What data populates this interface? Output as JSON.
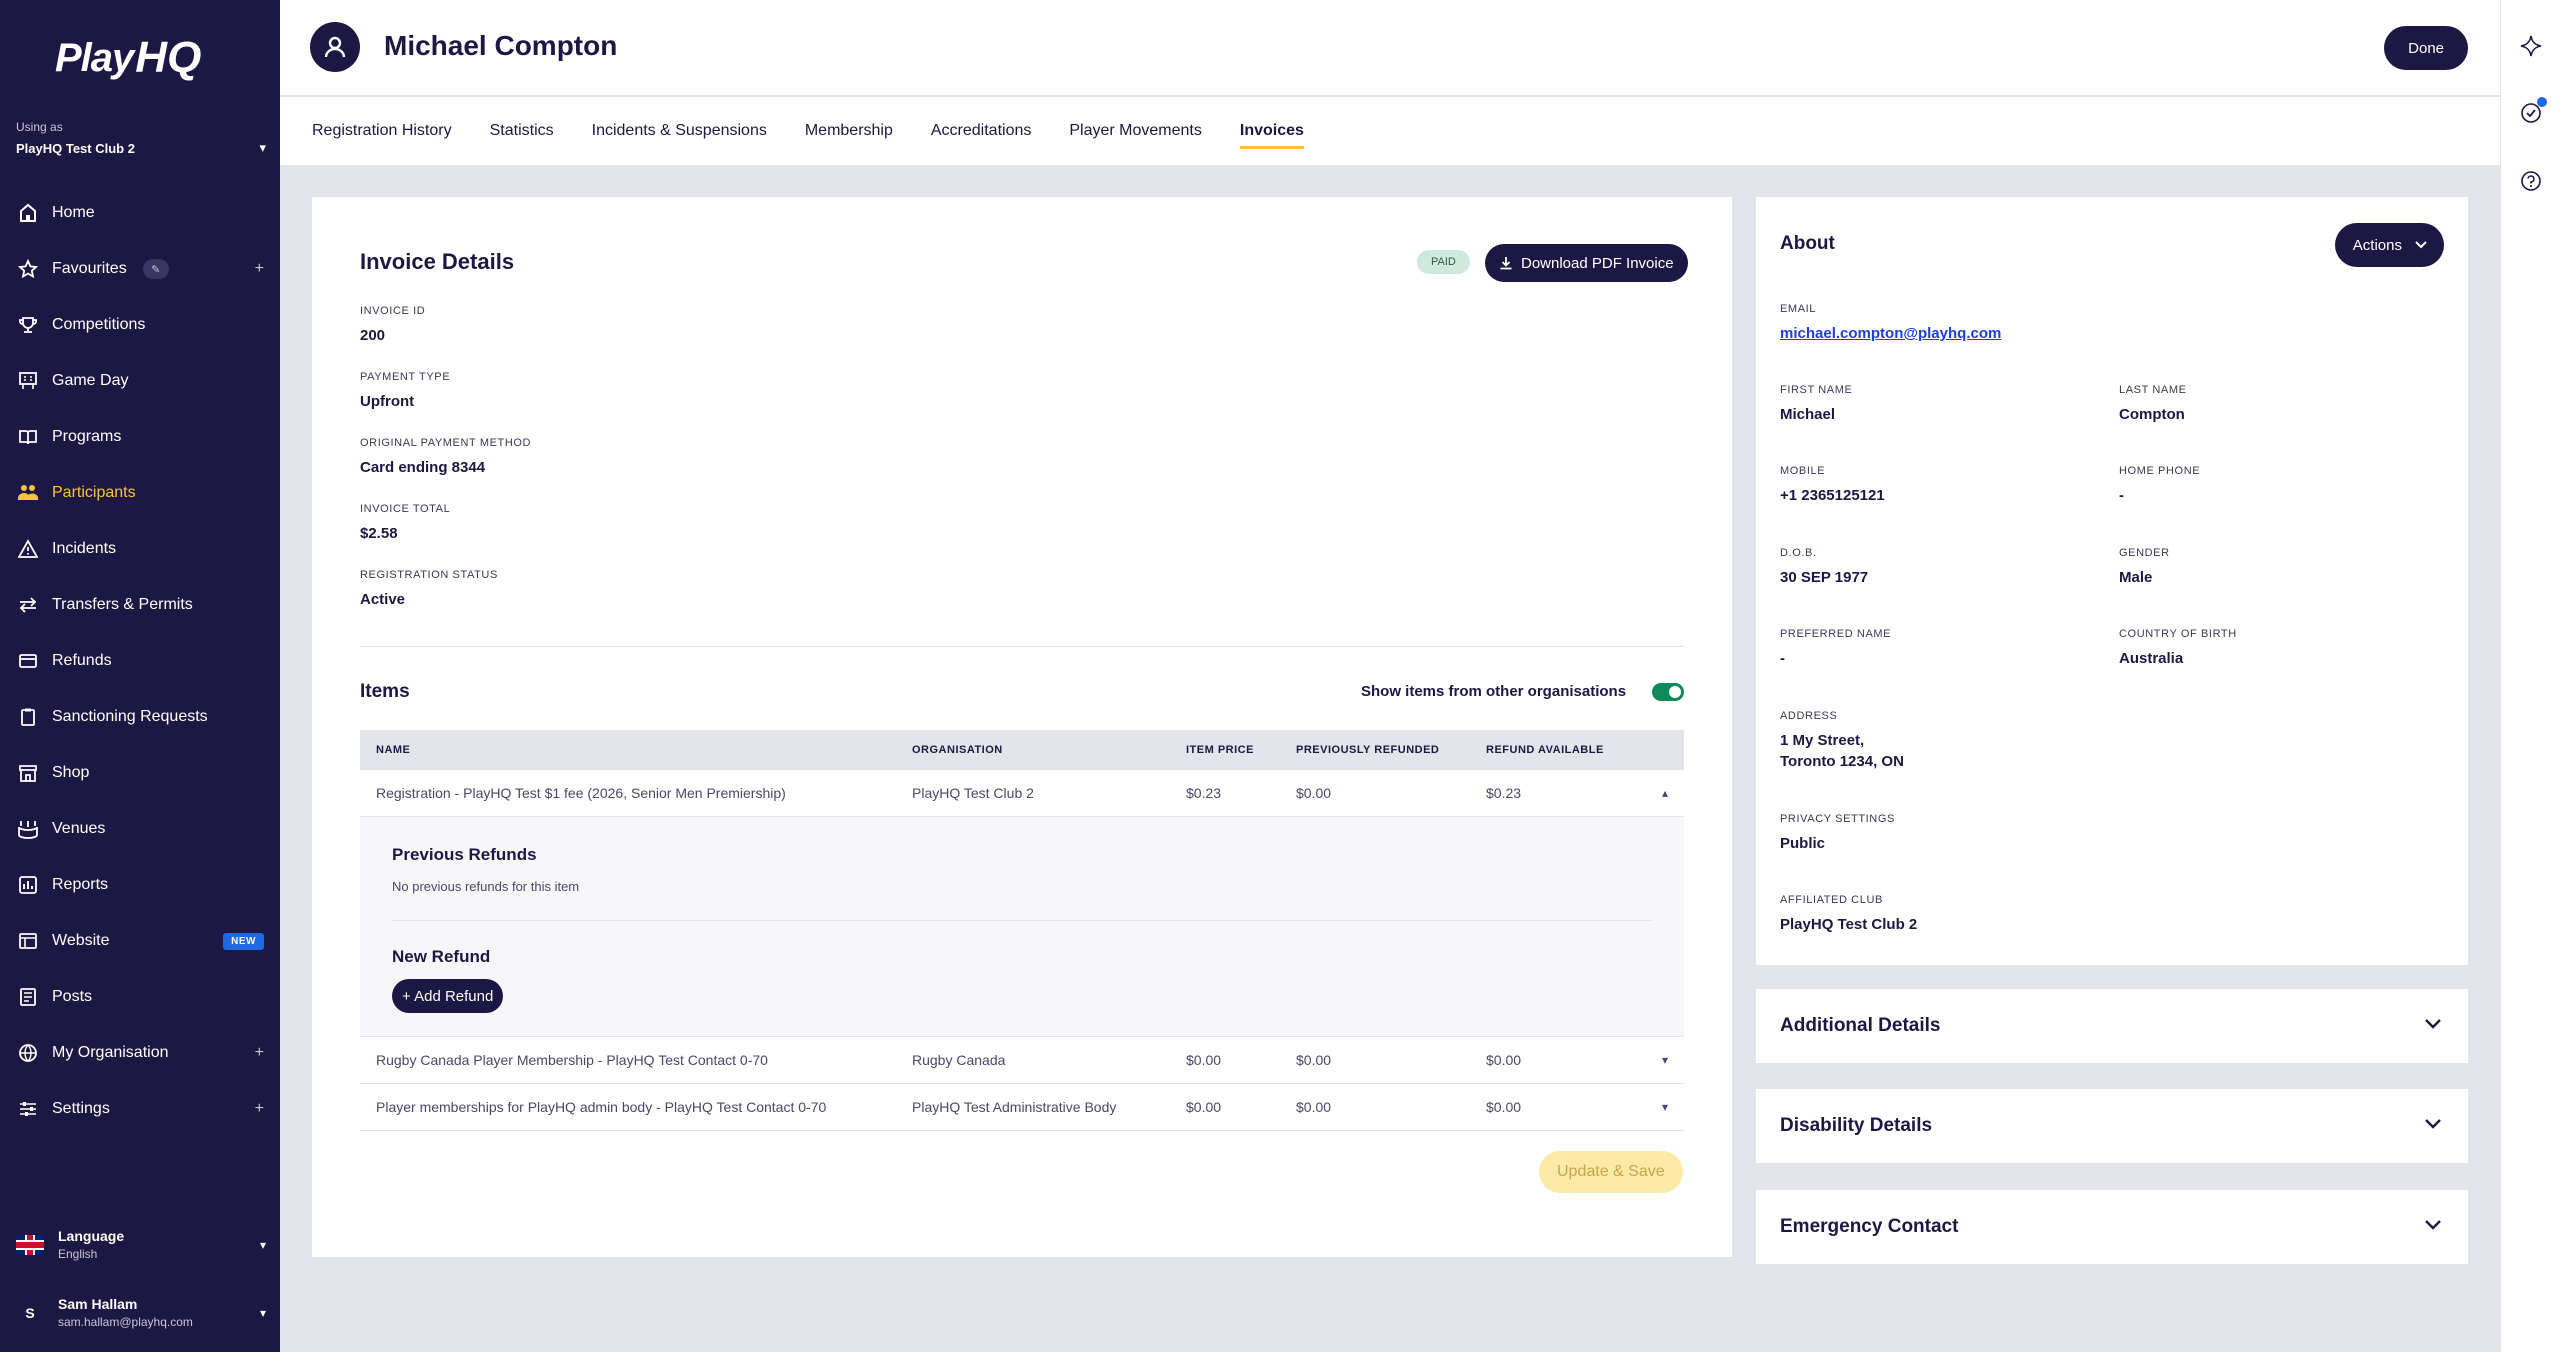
{
  "sidebar": {
    "logo_play": "Play",
    "logo_hq": "HQ",
    "using_as_label": "Using as",
    "org_name": "PlayHQ Test Club 2",
    "items": [
      {
        "label": "Home",
        "icon": "home-icon"
      },
      {
        "label": "Favourites",
        "icon": "star-icon"
      },
      {
        "label": "Competitions",
        "icon": "trophy-icon"
      },
      {
        "label": "Game Day",
        "icon": "scoreboard-icon"
      },
      {
        "label": "Programs",
        "icon": "book-icon"
      },
      {
        "label": "Participants",
        "icon": "people-icon"
      },
      {
        "label": "Incidents",
        "icon": "warning-icon"
      },
      {
        "label": "Transfers & Permits",
        "icon": "transfer-icon"
      },
      {
        "label": "Refunds",
        "icon": "card-icon"
      },
      {
        "label": "Sanctioning Requests",
        "icon": "clipboard-icon"
      },
      {
        "label": "Shop",
        "icon": "shop-icon"
      },
      {
        "label": "Venues",
        "icon": "stadium-icon"
      },
      {
        "label": "Reports",
        "icon": "report-icon"
      },
      {
        "label": "Website",
        "icon": "website-icon"
      },
      {
        "label": "Posts",
        "icon": "posts-icon"
      },
      {
        "label": "My Organisation",
        "icon": "globe-icon"
      },
      {
        "label": "Settings",
        "icon": "sliders-icon"
      }
    ],
    "website_badge": "NEW",
    "plus_symbol": "+",
    "language_label": "Language",
    "language_value": "English",
    "user_initial": "S",
    "user_name": "Sam Hallam",
    "user_email": "sam.hallam@playhq.com"
  },
  "header": {
    "title": "Michael Compton",
    "done_label": "Done"
  },
  "tabs": [
    {
      "label": "Registration History"
    },
    {
      "label": "Statistics"
    },
    {
      "label": "Incidents & Suspensions"
    },
    {
      "label": "Membership"
    },
    {
      "label": "Accreditations"
    },
    {
      "label": "Player Movements"
    },
    {
      "label": "Invoices",
      "active": true
    }
  ],
  "invoice": {
    "title": "Invoice Details",
    "status_badge": "PAID",
    "download_label": "Download PDF Invoice",
    "fields": [
      {
        "label": "Invoice ID",
        "value": "200"
      },
      {
        "label": "Payment Type",
        "value": "Upfront"
      },
      {
        "label": "Original Payment Method",
        "value": "Card ending 8344"
      },
      {
        "label": "Invoice Total",
        "value": "$2.58"
      },
      {
        "label": "Registration Status",
        "value": "Active"
      }
    ],
    "items_title": "Items",
    "toggle_label": "Show items from other organisations",
    "table": {
      "headers": [
        "NAME",
        "ORGANISATION",
        "ITEM PRICE",
        "PREVIOUSLY REFUNDED",
        "REFUND AVAILABLE"
      ],
      "rows": [
        {
          "name": "Registration - PlayHQ Test $1 fee (2026, Senior Men Premiership)",
          "org": "PlayHQ Test Club 2",
          "price": "$0.23",
          "prev": "$0.00",
          "avail": "$0.23",
          "toggle": "▴"
        },
        {
          "name": "Rugby Canada Player Membership - PlayHQ Test Contact 0-70",
          "org": "Rugby Canada",
          "price": "$0.00",
          "prev": "$0.00",
          "avail": "$0.00",
          "toggle": "▾"
        },
        {
          "name": "Player memberships for PlayHQ admin body - PlayHQ Test Contact 0-70",
          "org": "PlayHQ Test Administrative Body",
          "price": "$0.00",
          "prev": "$0.00",
          "avail": "$0.00",
          "toggle": "▾"
        }
      ]
    },
    "expanded": {
      "prev_title": "Previous Refunds",
      "prev_text": "No previous refunds for this item",
      "new_title": "New Refund",
      "add_label": "+ Add Refund"
    },
    "save_label": "Update & Save"
  },
  "about": {
    "title": "About",
    "actions_label": "Actions",
    "email_label": "EMAIL",
    "email": "michael.compton@playhq.com",
    "fields": [
      {
        "label": "FIRST NAME",
        "value": "Michael"
      },
      {
        "label": "LAST NAME",
        "value": "Compton"
      },
      {
        "label": "MOBILE",
        "value": "+1 2365125121"
      },
      {
        "label": "HOME PHONE",
        "value": "-"
      },
      {
        "label": "D.O.B.",
        "value": "30 SEP 1977"
      },
      {
        "label": "GENDER",
        "value": "Male"
      },
      {
        "label": "PREFERRED NAME",
        "value": "-"
      },
      {
        "label": "COUNTRY OF BIRTH",
        "value": "Australia"
      }
    ],
    "address_label": "ADDRESS",
    "address_line1": "1 My Street,",
    "address_line2": "Toronto 1234, ON",
    "privacy_label": "PRIVACY SETTINGS",
    "privacy_value": "Public",
    "club_label": "AFFILIATED CLUB",
    "club_value": "PlayHQ Test Club 2"
  },
  "accordions": [
    {
      "label": "Additional Details"
    },
    {
      "label": "Disability Details"
    },
    {
      "label": "Emergency Contact"
    }
  ],
  "colors": {
    "navy": "#1d1743",
    "accent_yellow": "#f8c43c",
    "toggle_green": "#0e8a5a",
    "link_blue": "#1f3fdd"
  }
}
